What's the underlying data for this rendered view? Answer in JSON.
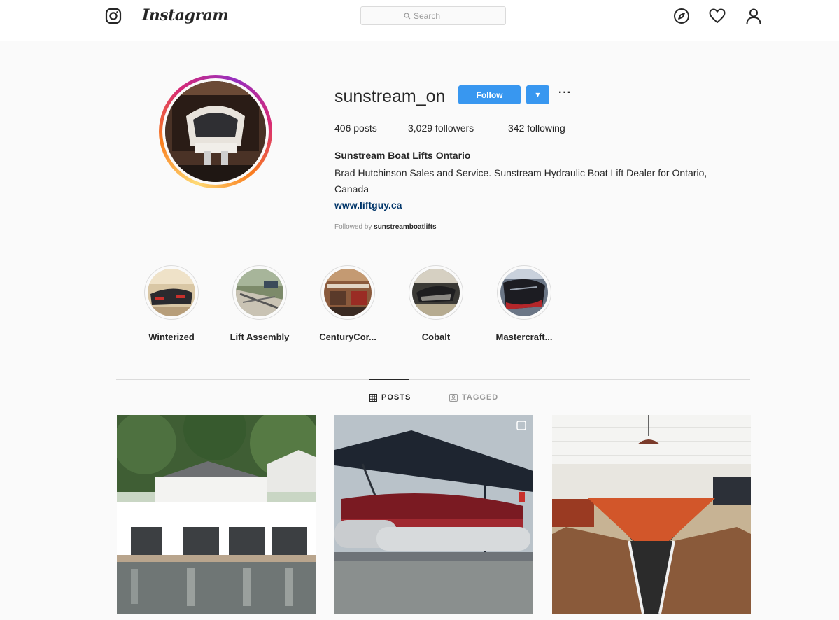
{
  "nav": {
    "logo_text": "Instagram",
    "search_placeholder": "Search",
    "icons": [
      "instagram-camera-icon",
      "explore-compass-icon",
      "heart-icon",
      "profile-person-icon"
    ]
  },
  "profile": {
    "username": "sunstream_on",
    "follow_label": "Follow",
    "dropdown_glyph": "▼",
    "more_glyph": "···",
    "stats": {
      "posts": "406 posts",
      "followers": "3,029 followers",
      "following": "342 following"
    },
    "full_name": "Sunstream Boat Lifts Ontario",
    "bio": "Brad Hutchinson Sales and Service. Sunstream Hydraulic Boat Lift Dealer for Ontario, Canada",
    "website": "www.liftguy.ca",
    "followed_by_prefix": "Followed by",
    "followed_by_user": "sunstreamboatlifts"
  },
  "highlights": [
    {
      "label": "Winterized"
    },
    {
      "label": "Lift Assembly"
    },
    {
      "label": "CenturyCor..."
    },
    {
      "label": "Cobalt"
    },
    {
      "label": "Mastercraft..."
    }
  ],
  "tabs": [
    {
      "label": "POSTS",
      "icon": "grid-icon",
      "active": true
    },
    {
      "label": "TAGGED",
      "icon": "tagged-icon",
      "active": false
    }
  ],
  "posts": [
    {
      "icon": "boathouse-photo"
    },
    {
      "icon": "pontoon-lift-photo",
      "badge": "multi-photo-icon"
    },
    {
      "icon": "wooden-boat-photo"
    }
  ],
  "colors": {
    "accent": "#3897f0",
    "link": "#003569",
    "text": "#262626",
    "muted": "#8e8e8e"
  }
}
